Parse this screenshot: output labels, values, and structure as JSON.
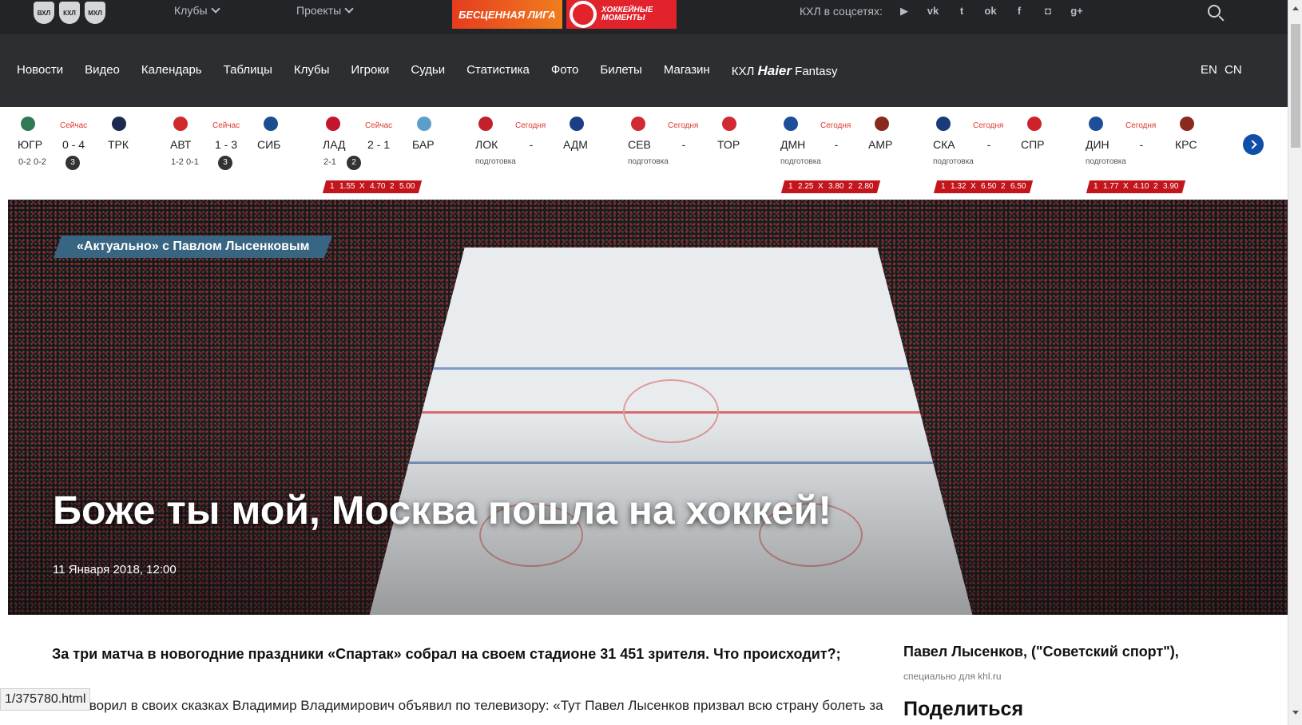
{
  "topbar": {
    "league_logos": [
      "ВХЛ",
      "КХЛ",
      "МХЛ"
    ],
    "clubs_label": "Клубы",
    "projects_label": "Проекты",
    "promo_1": "БЕСЦЕННАЯ ЛИГА",
    "promo_2_line1": "ХОККЕЙНЫЕ",
    "promo_2_line2": "МОМЕНТЫ",
    "social_label": "КХЛ в соцсетях:",
    "social_icons": [
      "youtube-icon",
      "vk-icon",
      "twitter-icon",
      "odnoklassniki-icon",
      "facebook-icon",
      "instagram-icon",
      "google-plus-icon"
    ]
  },
  "nav": {
    "items": [
      "Новости",
      "Видео",
      "Календарь",
      "Таблицы",
      "Клубы",
      "Игроки",
      "Судьи",
      "Статистика",
      "Фото",
      "Билеты",
      "Магазин"
    ],
    "fantasy_prefix": "КХЛ",
    "fantasy_brand": "Haier",
    "fantasy_suffix": "Fantasy",
    "lang_en": "EN",
    "lang_cn": "CN"
  },
  "matches": [
    {
      "home": "ЮГР",
      "away": "ТРК",
      "status": "Сейчас",
      "score": "0 - 4",
      "periods": "0-2   0-2",
      "period": "3",
      "home_color": "#2f7a52",
      "away_color": "#1b2a4d"
    },
    {
      "home": "АВТ",
      "away": "СИБ",
      "status": "Сейчас",
      "score": "1 - 3",
      "periods": "1-2   0-1",
      "period": "3",
      "home_color": "#d12a2a",
      "away_color": "#1b4e8f"
    },
    {
      "home": "ЛАД",
      "away": "БАР",
      "status": "Сейчас",
      "score": "2 - 1",
      "periods": "2-1",
      "period": "2",
      "home_color": "#c4162b",
      "away_color": "#5b9fc9",
      "odds": [
        "1",
        "1.55",
        "X",
        "4.70",
        "2",
        "5.00"
      ]
    },
    {
      "home": "ЛОК",
      "away": "АДМ",
      "status": "Сегодня",
      "score": "-",
      "sub": "подготовка",
      "home_color": "#c2202a",
      "away_color": "#1b3f86"
    },
    {
      "home": "СЕВ",
      "away": "ТОР",
      "status": "Сегодня",
      "score": "-",
      "sub": "подготовка",
      "home_color": "#d22a32",
      "away_color": "#d22a32"
    },
    {
      "home": "ДМН",
      "away": "АМР",
      "status": "Сегодня",
      "score": "-",
      "sub": "подготовка",
      "home_color": "#1c4e9c",
      "away_color": "#8a2a1e",
      "odds": [
        "1",
        "2.25",
        "X",
        "3.80",
        "2",
        "2.80"
      ]
    },
    {
      "home": "СКА",
      "away": "СПР",
      "status": "Сегодня",
      "score": "-",
      "sub": "подготовка",
      "home_color": "#1b3a7a",
      "away_color": "#cf2129",
      "odds": [
        "1",
        "1.32",
        "X",
        "6.50",
        "2",
        "6.50"
      ]
    },
    {
      "home": "ДИН",
      "away": "КРС",
      "status": "Сегодня",
      "score": "-",
      "sub": "подготовка",
      "home_color": "#1c4e9c",
      "away_color": "#8a2a1e",
      "odds": [
        "1",
        "1.77",
        "X",
        "4.10",
        "2",
        "3.90"
      ]
    }
  ],
  "hero": {
    "tag": "«Актуально» с Павлом Лысенковым",
    "title": "Боже ты мой, Москва пошла на хоккей!",
    "date": "11 Января 2018, 12:00"
  },
  "article": {
    "lead": "За три матча в новогодние праздники «Спартак» собрал на своем стадионе 31 451 зрителя. Что происходит?;",
    "body": "Как говорил в своих сказках Владимир Владимирович объявил по телевизору: «Тут Павел Лысенков призвал всю страну болеть за",
    "author": "Павел Лысенков, (\"Советский спорт\"),",
    "author_sub": "специально для khl.ru",
    "share": "Поделиться"
  },
  "status_bar": {
    "url": "1/375780.html"
  },
  "colors": {
    "topbar": "#222427",
    "nav": "#2c2e31",
    "accent_red": "#c3161c",
    "tag_blue": "#386581",
    "next_blue": "#0f4fa8"
  }
}
